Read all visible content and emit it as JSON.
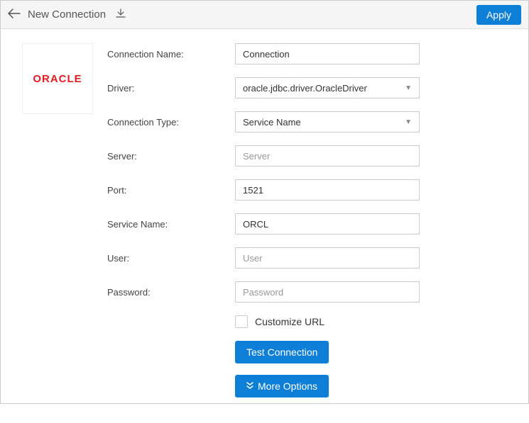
{
  "header": {
    "title": "New Connection",
    "apply_label": "Apply"
  },
  "logo": {
    "text": "ORACLE"
  },
  "form": {
    "connection_name": {
      "label": "Connection Name:",
      "value": "Connection"
    },
    "driver": {
      "label": "Driver:",
      "value": "oracle.jdbc.driver.OracleDriver"
    },
    "connection_type": {
      "label": "Connection Type:",
      "value": "Service Name"
    },
    "server": {
      "label": "Server:",
      "placeholder": "Server",
      "value": ""
    },
    "port": {
      "label": "Port:",
      "value": "1521"
    },
    "service_name": {
      "label": "Service Name:",
      "value": "ORCL"
    },
    "user": {
      "label": "User:",
      "placeholder": "User",
      "value": ""
    },
    "password": {
      "label": "Password:",
      "placeholder": "Password",
      "value": ""
    },
    "customize_url": {
      "label": "Customize URL",
      "checked": false
    },
    "test_connection_label": "Test Connection",
    "more_options_label": "More Options"
  }
}
